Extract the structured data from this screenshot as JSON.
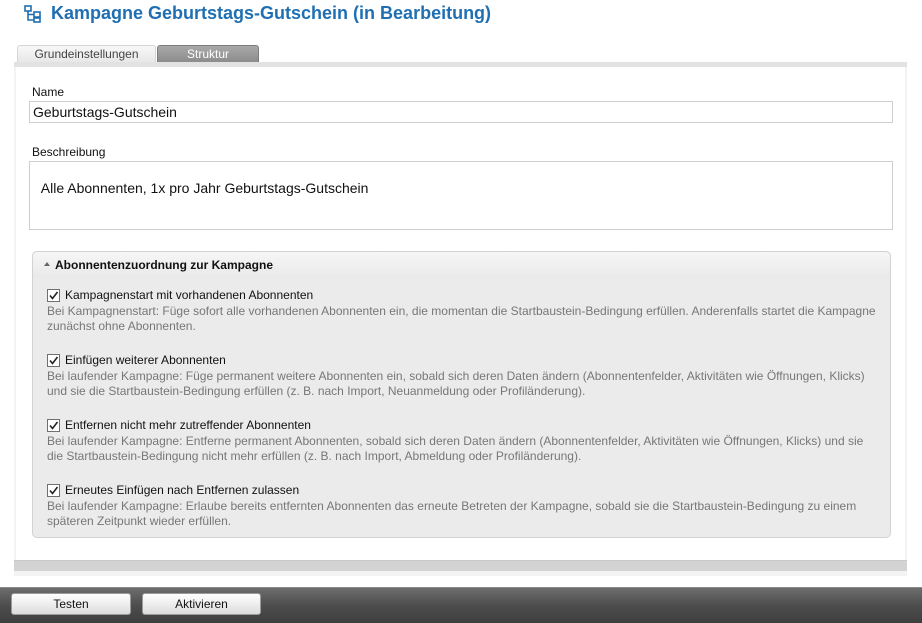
{
  "header": {
    "icon": "workflow-icon",
    "title": "Kampagne Geburtstags-Gutschein (in Bearbeitung)",
    "title_color": "#1f6fb2"
  },
  "tabs": [
    {
      "label": "Grundeinstellungen",
      "active": false
    },
    {
      "label": "Struktur",
      "active": true
    }
  ],
  "form": {
    "name_label": "Name",
    "name_value": "Geburtstags-Gutschein",
    "description_label": "Beschreibung",
    "description_value": "Alle Abonnenten, 1x pro Jahr Geburtstags-Gutschein"
  },
  "assignment": {
    "title": "Abonnentenzuordnung zur Kampagne",
    "options": [
      {
        "label": "Kampagnenstart mit vorhandenen Abonnenten",
        "checked": true,
        "description": "Bei Kampagnenstart: Füge sofort alle vorhandenen Abonnenten ein, die momentan die Startbaustein-Bedingung erfüllen. Anderenfalls startet die Kampagne zunächst ohne Abonnenten."
      },
      {
        "label": "Einfügen weiterer Abonnenten",
        "checked": true,
        "description": "Bei laufender Kampagne: Füge permanent weitere Abonnenten ein, sobald sich deren Daten ändern (Abonnentenfelder, Aktivitäten wie Öffnungen, Klicks) und sie die Startbaustein-Bedingung erfüllen (z. B. nach Import, Neuanmeldung oder Profiländerung)."
      },
      {
        "label": "Entfernen nicht mehr zutreffender Abonnenten",
        "checked": true,
        "description": "Bei laufender Kampagne: Entferne permanent Abonnenten, sobald sich deren Daten ändern (Abonnentenfelder, Aktivitäten wie Öffnungen, Klicks) und sie die Startbaustein-Bedingung nicht mehr erfüllen (z. B. nach Import, Abmeldung oder Profiländerung)."
      },
      {
        "label": "Erneutes Einfügen nach Entfernen zulassen",
        "checked": true,
        "description": "Bei laufender Kampagne: Erlaube bereits entfernten Abonnenten das erneute Betreten der Kampagne, sobald sie die Startbaustein-Bedingung zu einem späteren Zeitpunkt wieder erfüllen."
      }
    ]
  },
  "footer": {
    "test_label": "Testen",
    "activate_label": "Aktivieren"
  }
}
